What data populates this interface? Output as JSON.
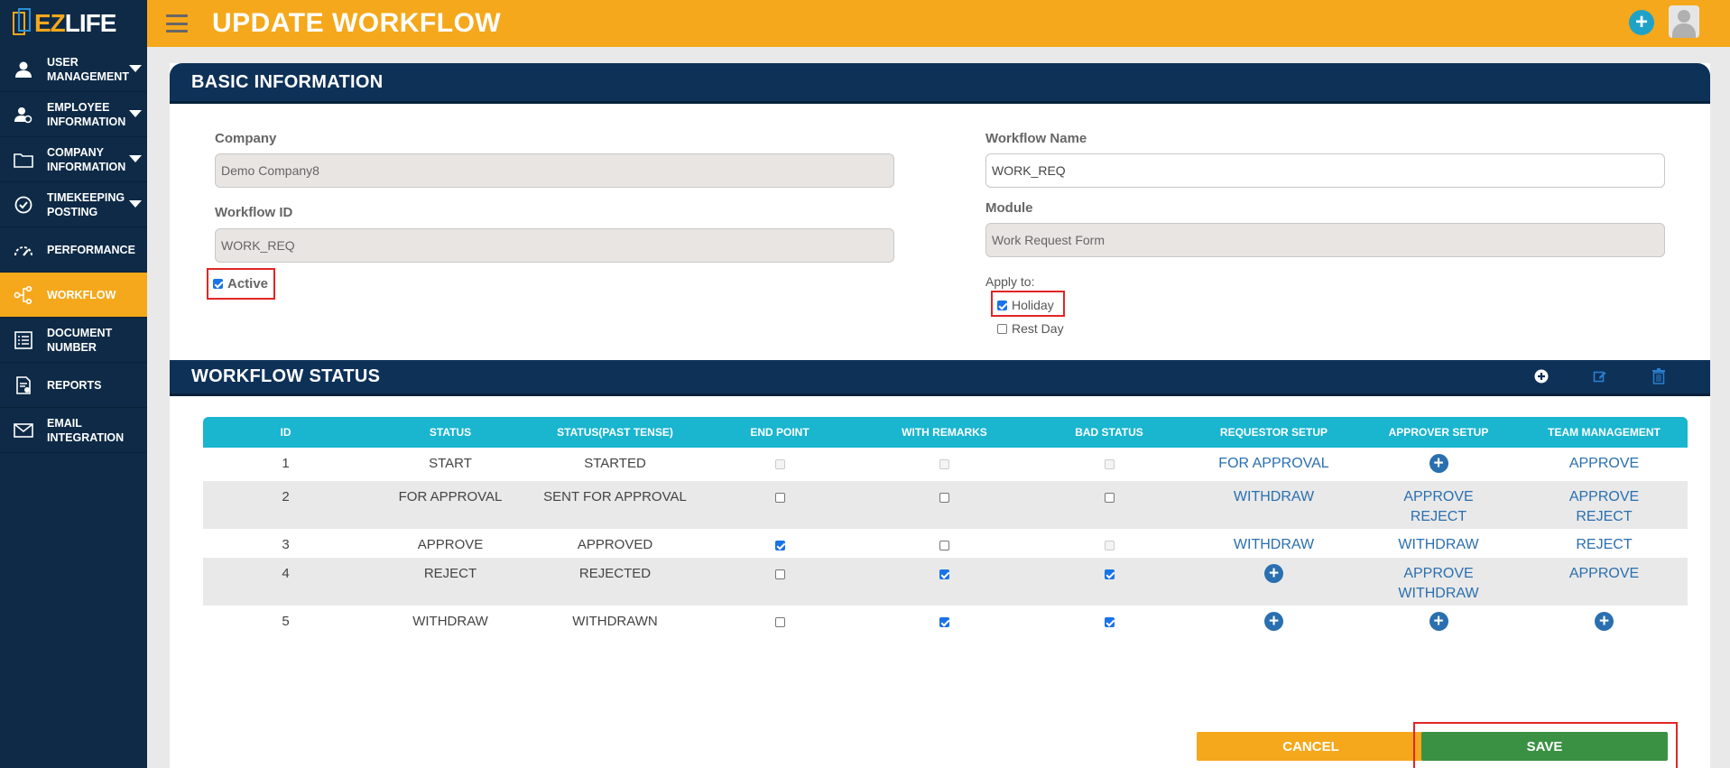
{
  "app": {
    "logo_ez": "EZ",
    "logo_life": "LIFE",
    "title": "UPDATE WORKFLOW"
  },
  "sidebar": {
    "items": [
      {
        "label": "USER MANAGEMENT",
        "icon": "user-icon",
        "expandable": true
      },
      {
        "label": "EMPLOYEE INFORMATION",
        "icon": "employee-icon",
        "expandable": true
      },
      {
        "label": "COMPANY INFORMATION",
        "icon": "folder-icon",
        "expandable": true
      },
      {
        "label": "TIMEKEEPING POSTING",
        "icon": "check-circle-icon",
        "expandable": true
      },
      {
        "label": "PERFORMANCE",
        "icon": "gauge-icon",
        "expandable": false
      },
      {
        "label": "WORKFLOW",
        "icon": "workflow-icon",
        "expandable": false,
        "active": true
      },
      {
        "label": "DOCUMENT NUMBER",
        "icon": "list-icon",
        "expandable": false
      },
      {
        "label": "REPORTS",
        "icon": "report-icon",
        "expandable": false
      },
      {
        "label": "EMAIL INTEGRATION",
        "icon": "mail-icon",
        "expandable": false
      }
    ]
  },
  "basic": {
    "heading": "BASIC INFORMATION",
    "company_label": "Company",
    "company_value": "Demo Company8",
    "workflow_id_label": "Workflow ID",
    "workflow_id_value": "WORK_REQ",
    "active_label": "Active",
    "active_checked": true,
    "workflow_name_label": "Workflow Name",
    "workflow_name_value": "WORK_REQ",
    "module_label": "Module",
    "module_value": "Work Request Form",
    "apply_to_label": "Apply to:",
    "holiday_label": "Holiday",
    "holiday_checked": true,
    "rest_day_label": "Rest Day",
    "rest_day_checked": false
  },
  "status": {
    "heading": "WORKFLOW STATUS",
    "columns": [
      "ID",
      "STATUS",
      "STATUS(PAST TENSE)",
      "END POINT",
      "WITH REMARKS",
      "BAD STATUS",
      "REQUESTOR SETUP",
      "APPROVER SETUP",
      "TEAM MANAGEMENT"
    ],
    "rows": [
      {
        "id": "1",
        "status": "START",
        "past": "STARTED",
        "end_point": "disabled",
        "with_remarks": "disabled",
        "bad_status": "disabled",
        "requestor": [
          "FOR APPROVAL"
        ],
        "approver": [],
        "team": [
          "APPROVE"
        ]
      },
      {
        "id": "2",
        "status": "FOR APPROVAL",
        "past": "SENT FOR APPROVAL",
        "end_point": "unchecked",
        "with_remarks": "unchecked",
        "bad_status": "unchecked",
        "requestor": [
          "WITHDRAW"
        ],
        "approver": [
          "APPROVE",
          "REJECT"
        ],
        "team": [
          "APPROVE",
          "REJECT"
        ]
      },
      {
        "id": "3",
        "status": "APPROVE",
        "past": "APPROVED",
        "end_point": "checked",
        "with_remarks": "unchecked",
        "bad_status": "disabled",
        "requestor": [
          "WITHDRAW"
        ],
        "approver": [
          "WITHDRAW"
        ],
        "team": [
          "REJECT"
        ]
      },
      {
        "id": "4",
        "status": "REJECT",
        "past": "REJECTED",
        "end_point": "unchecked",
        "with_remarks": "checked",
        "bad_status": "checked",
        "requestor": [],
        "approver": [
          "APPROVE",
          "WITHDRAW"
        ],
        "team": [
          "APPROVE"
        ]
      },
      {
        "id": "5",
        "status": "WITHDRAW",
        "past": "WITHDRAWN",
        "end_point": "unchecked",
        "with_remarks": "checked",
        "bad_status": "checked",
        "requestor": [],
        "approver": [],
        "team": []
      }
    ]
  },
  "actions": {
    "cancel_label": "CANCEL",
    "save_label": "SAVE"
  },
  "colors": {
    "accent": "#f5a81c",
    "sidebar": "#0e2a47",
    "header": "#0e3158",
    "table_header": "#1ab5cf",
    "link": "#2a6fb0",
    "save": "#3a9143"
  }
}
